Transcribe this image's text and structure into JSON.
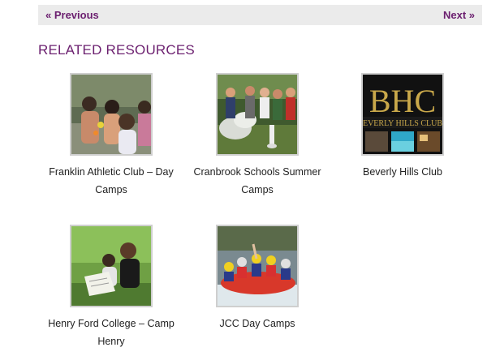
{
  "pager": {
    "previous_label": "« Previous",
    "next_label": "Next »"
  },
  "section": {
    "heading": "RELATED RESOURCES"
  },
  "resources": [
    {
      "title": "Franklin Athletic Club – Day Camps"
    },
    {
      "title": "Cranbrook Schools Summer Camps"
    },
    {
      "title": "Beverly Hills Club",
      "logo_text": "BHC",
      "logo_subtext": "EVERLY HILLS CLUB"
    },
    {
      "title": "Henry Ford College – Camp Henry"
    },
    {
      "title": "JCC Day Camps"
    }
  ],
  "colors": {
    "accent": "#6b1f6f",
    "pager_bg": "#ebebeb",
    "text": "#222222",
    "logo_gold": "#c9a84a"
  }
}
